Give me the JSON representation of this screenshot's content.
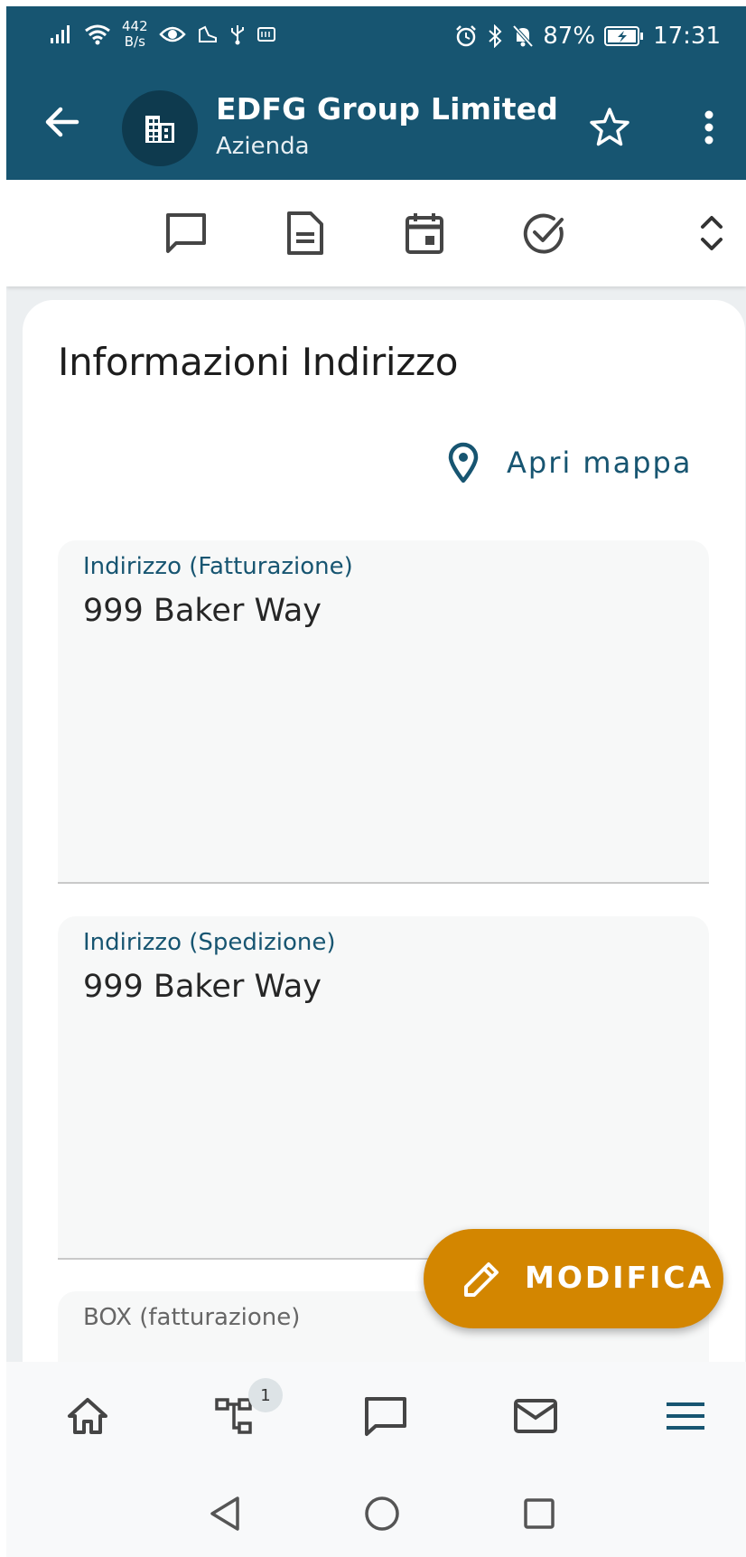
{
  "status_bar": {
    "speed_top": "442",
    "speed_bottom": "B/s",
    "battery": "87%",
    "time": "17:31"
  },
  "header": {
    "title": "EDFG Group Limited",
    "subtitle": "Azienda",
    "icons": [
      "arrow-left-icon",
      "building-icon",
      "star-outline-icon",
      "more-vertical-icon"
    ]
  },
  "toolbar": {
    "items": [
      "comment-icon",
      "document-icon",
      "calendar-icon",
      "check-circle-icon",
      "expand-collapse-icon"
    ]
  },
  "card": {
    "title": "Informazioni Indirizzo",
    "map_link": "Apri mappa",
    "fields": [
      {
        "label": "Indirizzo (Fatturazione)",
        "value": "999 Baker Way"
      },
      {
        "label": "Indirizzo (Spedizione)",
        "value": "999 Baker Way"
      },
      {
        "label": "BOX (fatturazione)",
        "value": ""
      }
    ]
  },
  "fab": {
    "label": "MODIFICA"
  },
  "bottom_nav": {
    "items": [
      "home-icon",
      "hierarchy-icon",
      "comment-icon",
      "mail-icon",
      "menu-icon"
    ],
    "badge": "1"
  },
  "colors": {
    "primary": "#175571",
    "accent": "#d38600",
    "field_bg": "#f7f8f8"
  }
}
